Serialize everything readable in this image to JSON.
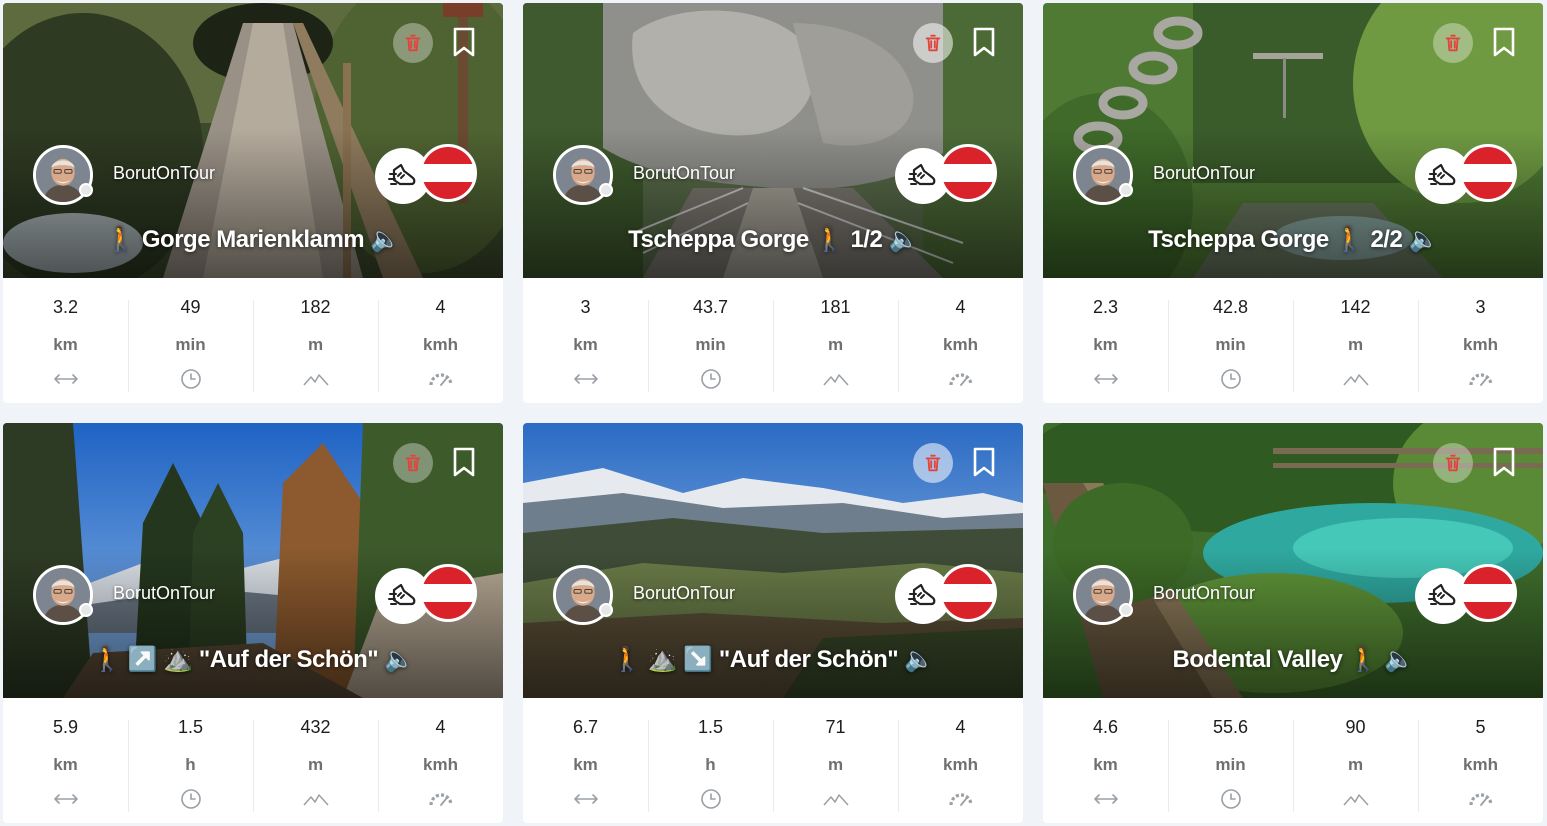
{
  "colors": {
    "background": "#f0f3f7",
    "card": "#ffffff",
    "flag_red": "#d9222a",
    "trash_red": "#e0443c",
    "text_dark": "#1d1d1d",
    "text_unit": "#707070"
  },
  "icons": {
    "trash": "trash-icon",
    "bookmark": "bookmark-icon",
    "activity": "walking-shoe-icon",
    "country": "austria-flag-icon",
    "distance": "arrows-horizontal-icon",
    "duration": "clock-icon",
    "elevation": "mountain-icon",
    "speed": "speedometer-icon"
  },
  "cards": [
    {
      "user": "BorutOnTour",
      "title": "🚶 Gorge Marienklamm 🔈",
      "stats": [
        {
          "value": "3.2",
          "unit": "km"
        },
        {
          "value": "49",
          "unit": "min"
        },
        {
          "value": "182",
          "unit": "m"
        },
        {
          "value": "4",
          "unit": "kmh"
        }
      ]
    },
    {
      "user": "BorutOnTour",
      "title": "Tscheppa Gorge 🚶 1/2 🔈",
      "stats": [
        {
          "value": "3",
          "unit": "km"
        },
        {
          "value": "43.7",
          "unit": "min"
        },
        {
          "value": "181",
          "unit": "m"
        },
        {
          "value": "4",
          "unit": "kmh"
        }
      ]
    },
    {
      "user": "BorutOnTour",
      "title": "Tscheppa Gorge 🚶 2/2 🔈",
      "stats": [
        {
          "value": "2.3",
          "unit": "km"
        },
        {
          "value": "42.8",
          "unit": "min"
        },
        {
          "value": "142",
          "unit": "m"
        },
        {
          "value": "3",
          "unit": "kmh"
        }
      ]
    },
    {
      "user": "BorutOnTour",
      "title": "🚶 ↗️ ⛰️ \"Auf der Schön\" 🔈",
      "stats": [
        {
          "value": "5.9",
          "unit": "km"
        },
        {
          "value": "1.5",
          "unit": "h"
        },
        {
          "value": "432",
          "unit": "m"
        },
        {
          "value": "4",
          "unit": "kmh"
        }
      ]
    },
    {
      "user": "BorutOnTour",
      "title": "🚶 ⛰️ ↘️ \"Auf der Schön\" 🔈",
      "stats": [
        {
          "value": "6.7",
          "unit": "km"
        },
        {
          "value": "1.5",
          "unit": "h"
        },
        {
          "value": "71",
          "unit": "m"
        },
        {
          "value": "4",
          "unit": "kmh"
        }
      ]
    },
    {
      "user": "BorutOnTour",
      "title": "Bodental Valley 🚶 🔈",
      "stats": [
        {
          "value": "4.6",
          "unit": "km"
        },
        {
          "value": "55.6",
          "unit": "min"
        },
        {
          "value": "90",
          "unit": "m"
        },
        {
          "value": "5",
          "unit": "kmh"
        }
      ]
    }
  ]
}
